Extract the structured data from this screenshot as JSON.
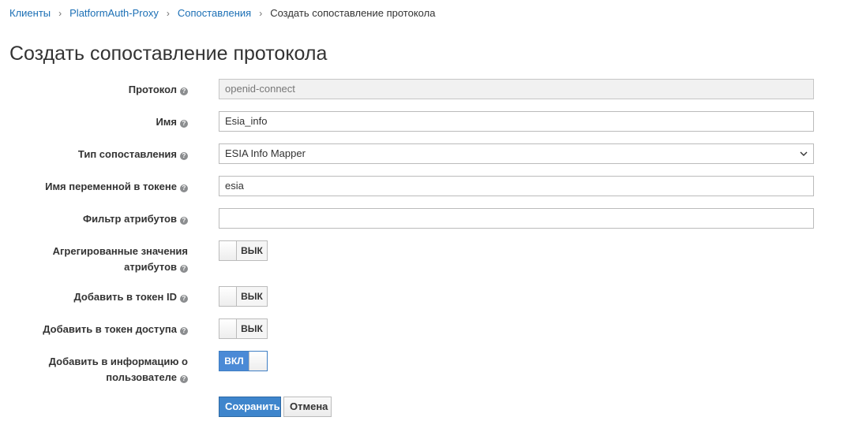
{
  "breadcrumb": {
    "items": [
      "Клиенты",
      "PlatformAuth-Proxy",
      "Сопоставления"
    ],
    "current": "Создать сопоставление протокола"
  },
  "page_title": "Создать сопоставление протокола",
  "form": {
    "protocol": {
      "label": "Протокол",
      "value": "openid-connect"
    },
    "name": {
      "label": "Имя",
      "value": "Esia_info"
    },
    "mapper_type": {
      "label": "Тип сопоставления",
      "value": "ESIA Info Mapper"
    },
    "token_claim": {
      "label": "Имя переменной в токене",
      "value": "esia"
    },
    "attr_filter": {
      "label": "Фильтр атрибутов",
      "value": ""
    },
    "aggregate": {
      "label_line1": "Агрегированные значения",
      "label_line2": "атрибутов",
      "state": "ВЫК"
    },
    "id_token": {
      "label": "Добавить в токен ID",
      "state": "ВЫК"
    },
    "access_token": {
      "label": "Добавить в токен доступа",
      "state": "ВЫК"
    },
    "userinfo": {
      "label_line1": "Добавить в информацию о",
      "label_line2": "пользователе",
      "state": "ВКЛ"
    }
  },
  "buttons": {
    "save": "Сохранить",
    "cancel": "Отмена"
  },
  "colors": {
    "link": "#1b6fb5",
    "primary": "#3e85cc",
    "toggle_on": "#4b8ad6"
  }
}
